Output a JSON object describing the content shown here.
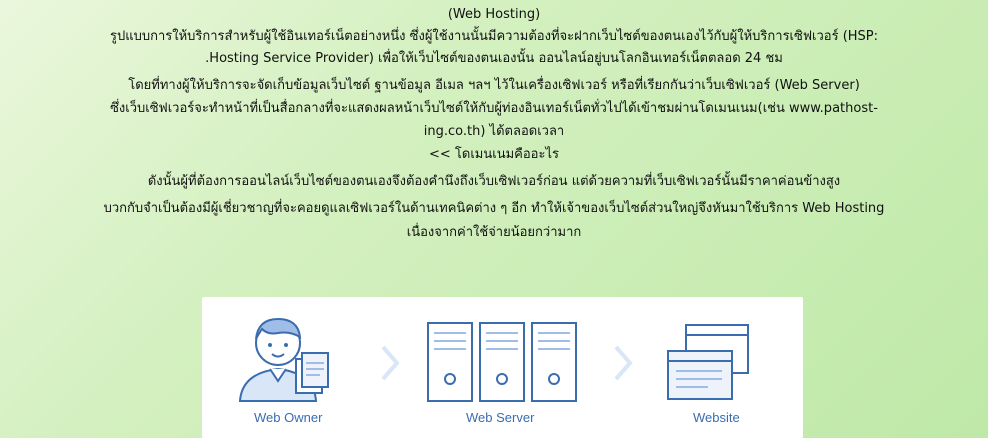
{
  "lines": [
    "(Web Hosting)",
    "รูปแบบการให้บริการสำหรับผู้ใช้อินเทอร์เน็ตอย่างหนึ่ง ซึ่งผู้ใช้งานนั้นมีความต้องที่จะฝากเว็บไซต์ของตนเองไว้กับผู้ให้บริการเซิฟเวอร์ (HSP:",
    ".Hosting Service Provider) เพื่อให้เว็บไซต์ของตนเองนั้น ออนไลน์อยู่บนโลกอินเทอร์เน็ตตลอด 24 ชม",
    "โดยที่ทางผู้ให้บริการจะจัดเก็บข้อมูลเว็บไซต์ ฐานข้อมูล อีเมล ฯลฯ ไว้ในเครื่องเซิฟเวอร์ หรือที่เรียกกันว่าเว็บเซิฟเวอร์ (Web Server)",
    "ซึ่งเว็บเซิฟเวอร์จะทำหน้าที่เป็นสื่อกลางที่จะแสดงผลหน้าเว็บไซต์ให้กับผู้ท่องอินเทอร์เน็ตทั่วไปได้เข้าชมผ่านโดเมนเนม(เช่น www.pathost-",
    "ing.co.th) ได้ตลอดเวลา",
    "<< โดเมนเนมคืออะไร",
    "ดังนั้นผู้ที่ต้องการออนไลน์เว็บไซต์ของตนเองจึงต้องคำนึงถึงเว็บเซิฟเวอร์ก่อน แต่ด้วยความที่เว็บเซิฟเวอร์นั้นมีราคาค่อนข้างสูง",
    "บวกกับจำเป็นต้องมีผู้เชี่ยวชาญที่จะคอยดูแลเซิฟเวอร์ในด้านเทคนิคต่าง ๆ อีก ทำให้เจ้าของเว็บไซต์ส่วนใหญ่จึงหันมาใช้บริการ Web Hosting",
    "เนื่องจากค่าใช้จ่ายน้อยกว่ามาก"
  ],
  "diagram": {
    "captions": [
      "Web Owner",
      "Web Server",
      "Website"
    ]
  },
  "colors": {
    "accent": "#3a6db0",
    "icon_light": "#d9e6f7",
    "icon_mid": "#9fbde6"
  }
}
